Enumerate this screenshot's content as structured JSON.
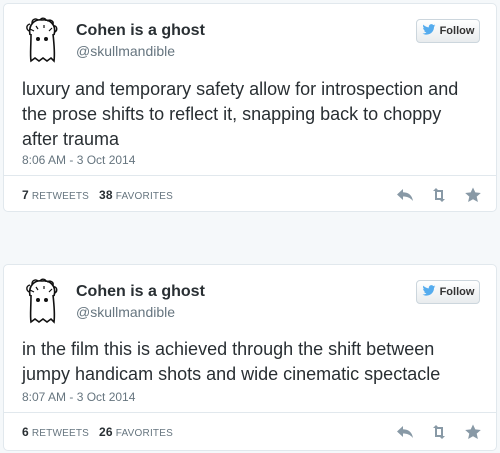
{
  "colors": {
    "background": "#f5f8fa",
    "card_border": "#e1e8ed",
    "muted_text": "#66757f",
    "twitter_blue": "#55acee",
    "icon_gray": "#8899a6"
  },
  "tweets": [
    {
      "display_name": "Cohen is a ghost",
      "screen_name": "@skullmandible",
      "follow_label": "Follow",
      "text": "luxury and temporary safety allow for introspection and the prose shifts to reflect it, snapping back to choppy after trauma",
      "timestamp": "8:06 AM - 3 Oct 2014",
      "retweets_count": "7",
      "retweets_label": "RETWEETS",
      "favorites_count": "38",
      "favorites_label": "FAVORITES",
      "icons": [
        "reply-icon",
        "retweet-icon",
        "favorite-icon"
      ]
    },
    {
      "display_name": "Cohen is a ghost",
      "screen_name": "@skullmandible",
      "follow_label": "Follow",
      "text": "in the film this is achieved through the shift between jumpy handicam shots and wide cinematic spectacle",
      "timestamp": "8:07 AM - 3 Oct 2014",
      "retweets_count": "6",
      "retweets_label": "RETWEETS",
      "favorites_count": "26",
      "favorites_label": "FAVORITES",
      "icons": [
        "reply-icon",
        "retweet-icon",
        "favorite-icon"
      ]
    }
  ]
}
